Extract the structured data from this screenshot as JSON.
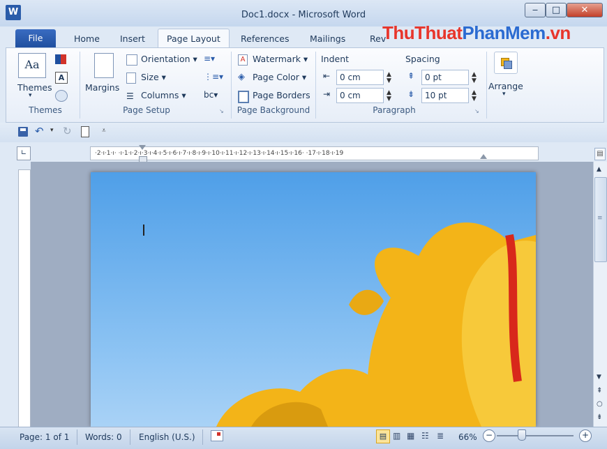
{
  "window": {
    "title": "Doc1.docx - Microsoft Word",
    "app_letter": "W",
    "minimize": "‒",
    "maximize": "□",
    "close": "✕"
  },
  "tabs": [
    {
      "label": "File"
    },
    {
      "label": "Home"
    },
    {
      "label": "Insert"
    },
    {
      "label": "Page Layout"
    },
    {
      "label": "References"
    },
    {
      "label": "Mailings"
    },
    {
      "label": "Rev"
    }
  ],
  "watermark": {
    "part1": "ThuThuat",
    "part2": "PhanMem",
    "part3": ".vn"
  },
  "ribbon": {
    "themes": {
      "button": "Themes",
      "group": "Themes"
    },
    "page_setup": {
      "margins": "Margins",
      "orientation": "Orientation",
      "size": "Size",
      "columns": "Columns",
      "group": "Page Setup"
    },
    "page_background": {
      "watermark": "Watermark",
      "page_color": "Page Color",
      "page_borders": "Page Borders",
      "group": "Page Background"
    },
    "paragraph": {
      "indent_label": "Indent",
      "spacing_label": "Spacing",
      "indent_left": "0 cm",
      "indent_right": "0 cm",
      "spacing_before": "0 pt",
      "spacing_after": "10 pt",
      "group": "Paragraph"
    },
    "arrange": {
      "button": "Arrange"
    }
  },
  "ruler": {
    "text": "·2·ı·1·ı·  ·ı·1·ı·2·ı·3·ı·4·ı·5·ı·6·ı·7·ı·8·ı·9·ı·10·ı·11·ı·12·ı·13·ı·14·ı·15·ı·16·  ·17·ı·18·ı·19"
  },
  "status": {
    "page": "Page: 1 of 1",
    "words": "Words: 0",
    "language": "English (U.S.)",
    "zoom": "66%"
  },
  "colors": {
    "accent": "#2a5caa",
    "ribbon_bg": "#f6f9fd",
    "sky": "#6fb3ef",
    "petal": "#f3b418",
    "stripe": "#d8281b"
  }
}
